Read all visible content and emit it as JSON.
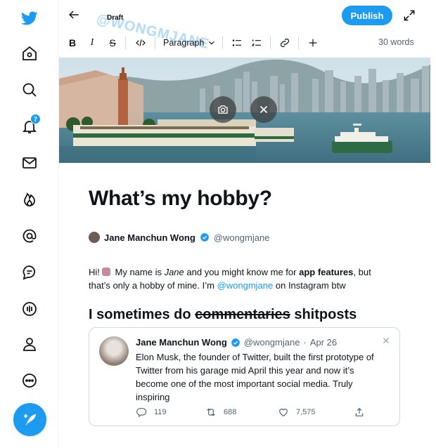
{
  "header": {
    "draft_label": "Draft",
    "watermark": "@WONGMJANE",
    "publish_label": "Publish"
  },
  "toolbar": {
    "bold": "B",
    "italic": "I",
    "strike": "S",
    "paragraph_style": "Paragraph",
    "word_count": "30 words"
  },
  "nav": {
    "notification_count": "7",
    "icons": [
      "twitter-logo-icon",
      "home-icon",
      "search-icon",
      "bell-icon",
      "mail-icon",
      "fire-icon",
      "at-icon",
      "topics-icon",
      "spaces-icon",
      "profile-icon",
      "more-icon",
      "compose-icon"
    ]
  },
  "article": {
    "title": "What’s my hobby?",
    "author_name": "Jane Manchun Wong",
    "author_handle": "@wongmjane",
    "para": {
      "p1": "Hi!",
      "p2": " My name is ",
      "p3": "Jane",
      "p4": " and you might know me for ",
      "p5": "app features",
      "p6": ", but that’s only a hobby of mine. I’m ",
      "p7": "@wongmjane",
      "p8": " on Instagram btw"
    },
    "subhead": {
      "s1": "I sometimes do ",
      "s2": "commentaries",
      "s3": " shitposts"
    }
  },
  "tweet": {
    "name": "Jane Manchun Wong",
    "handle": "@wongmjane",
    "dot": "·",
    "date": "Apr 26",
    "text": "Elon Musk, the founder of Twitter, built the first prototype of Twitter from his garage mid April this year and now it’s become one of the most important social media. Truly inspiring",
    "replies": "119",
    "retweets": "688",
    "likes": "7,575"
  },
  "colors": {
    "accent": "#1d9bf0",
    "text": "#0f1419",
    "secondary": "#536471"
  }
}
